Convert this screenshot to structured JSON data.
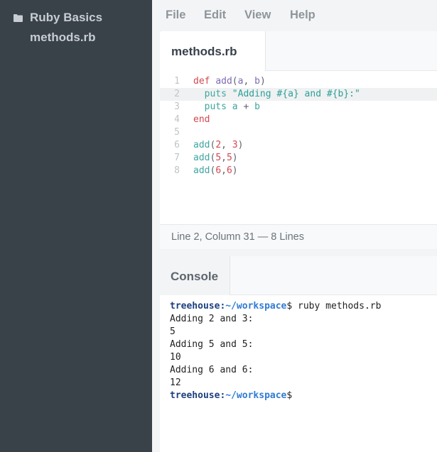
{
  "sidebar": {
    "project_name": "Ruby Basics",
    "files": [
      "methods.rb"
    ]
  },
  "menu": [
    "File",
    "Edit",
    "View",
    "Help"
  ],
  "editor": {
    "tab_label": "methods.rb",
    "lines": [
      [
        {
          "t": "def ",
          "c": "kw"
        },
        {
          "t": "add",
          "c": "fn"
        },
        {
          "t": "(",
          "c": "pn"
        },
        {
          "t": "a",
          "c": "fn"
        },
        {
          "t": ", ",
          "c": "pn"
        },
        {
          "t": "b",
          "c": "fn"
        },
        {
          "t": ")",
          "c": "pn"
        }
      ],
      [
        {
          "t": "  puts ",
          "c": "var"
        },
        {
          "t": "\"Adding #{a} and #{b}:\"",
          "c": "str"
        }
      ],
      [
        {
          "t": "  puts a ",
          "c": "var"
        },
        {
          "t": "+",
          "c": "pn"
        },
        {
          "t": " b",
          "c": "var"
        }
      ],
      [
        {
          "t": "end",
          "c": "kw"
        }
      ],
      [],
      [
        {
          "t": "add",
          "c": "var"
        },
        {
          "t": "(",
          "c": "pn"
        },
        {
          "t": "2",
          "c": "num"
        },
        {
          "t": ", ",
          "c": "pn"
        },
        {
          "t": "3",
          "c": "num"
        },
        {
          "t": ")",
          "c": "pn"
        }
      ],
      [
        {
          "t": "add",
          "c": "var"
        },
        {
          "t": "(",
          "c": "pn"
        },
        {
          "t": "5",
          "c": "num"
        },
        {
          "t": ",",
          "c": "pn"
        },
        {
          "t": "5",
          "c": "num"
        },
        {
          "t": ")",
          "c": "pn"
        }
      ],
      [
        {
          "t": "add",
          "c": "var"
        },
        {
          "t": "(",
          "c": "pn"
        },
        {
          "t": "6",
          "c": "num"
        },
        {
          "t": ",",
          "c": "pn"
        },
        {
          "t": "6",
          "c": "num"
        },
        {
          "t": ")",
          "c": "pn"
        }
      ]
    ],
    "active_line": 2,
    "status": "Line 2, Column 31 — 8 Lines"
  },
  "console": {
    "tab_label": "Console",
    "prompt_host": "treehouse:",
    "prompt_path": "~/workspace",
    "lines": [
      {
        "prompt": true,
        "text": "$ ruby methods.rb"
      },
      {
        "text": "Adding 2 and 3:"
      },
      {
        "text": "5"
      },
      {
        "text": "Adding 5 and 5:"
      },
      {
        "text": "10"
      },
      {
        "text": "Adding 6 and 6:"
      },
      {
        "text": "12"
      },
      {
        "prompt": true,
        "text": "$"
      }
    ]
  },
  "colors": {
    "sidebar_bg": "#394149",
    "keyword": "#d2484f",
    "function": "#7e6ab5",
    "string": "#2aa198",
    "prompt_host": "#1c3f80",
    "prompt_path": "#2f7bd4"
  },
  "icons": {
    "project": "folder-icon"
  }
}
